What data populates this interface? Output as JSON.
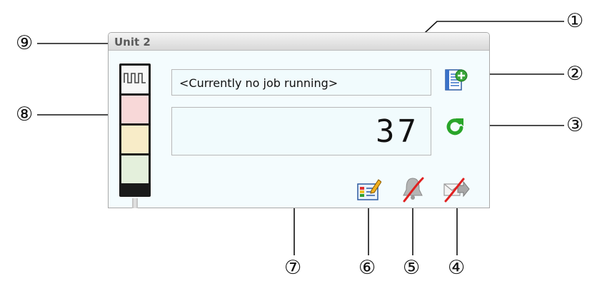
{
  "window": {
    "title": "Unit 2"
  },
  "job": {
    "status_text": "<Currently no job running>"
  },
  "counter": {
    "value": "37"
  },
  "tower": {
    "segments": [
      {
        "name": "top",
        "color": "#f8f8f8"
      },
      {
        "name": "red",
        "color": "#f8d8d8"
      },
      {
        "name": "yellow",
        "color": "#f8ecc8"
      },
      {
        "name": "green",
        "color": "#e4f0dc"
      }
    ]
  },
  "callouts": {
    "c1": "①",
    "c2": "②",
    "c3": "③",
    "c4": "④",
    "c5": "⑤",
    "c6": "⑥",
    "c7": "⑦",
    "c8": "⑧",
    "c9": "⑨"
  },
  "icons": {
    "add_job": "add-job-icon",
    "reset": "reset-icon",
    "edit_unit": "edit-unit-icon",
    "alarm_off": "alarm-off-icon",
    "mail_off": "mail-off-icon"
  },
  "colors": {
    "accent_green": "#2aa52a",
    "panel_bg": "#f4fcfe",
    "disabled_red": "#e02020"
  }
}
